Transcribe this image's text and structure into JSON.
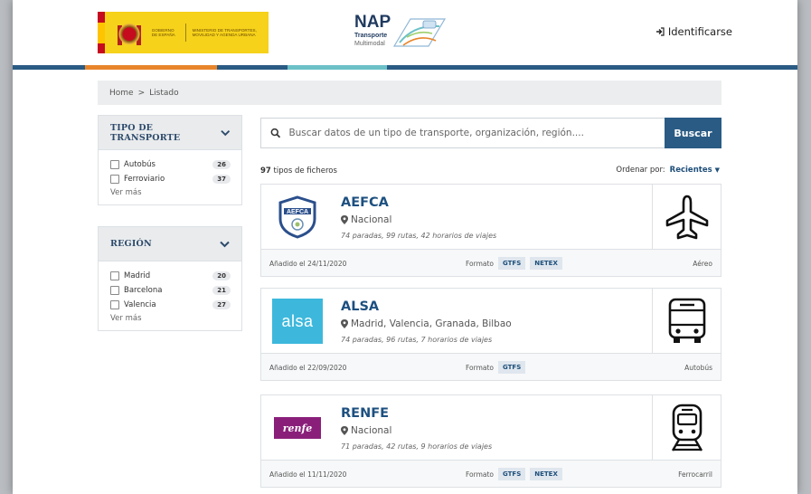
{
  "header": {
    "gov_text": "Gobierno de España",
    "ministry_text": "Ministerio de Transportes, Movilidad y Agenda Urbana",
    "nap_title": "NAP",
    "nap_subtitle": "Transporte",
    "nap_subtitle2": "Multimodal",
    "login_label": "Identificarse"
  },
  "colors": {
    "bar": [
      "#2a5b84",
      "#e8852b",
      "#2a5b84",
      "#6cc1c7",
      "#2a5b84"
    ],
    "accent": "#2a5b84",
    "link": "#1d5080"
  },
  "breadcrumb": {
    "home": "Home",
    "sep": ">",
    "current": "Listado"
  },
  "filters": {
    "transport": {
      "title": "TIPO DE TRANSPORTE",
      "options": [
        {
          "label": "Autobús",
          "count": "26"
        },
        {
          "label": "Ferroviario",
          "count": "37"
        }
      ],
      "more": "Ver más"
    },
    "region": {
      "title": "REGIÓN",
      "options": [
        {
          "label": "Madrid",
          "count": "20"
        },
        {
          "label": "Barcelona",
          "count": "21"
        },
        {
          "label": "Valencia",
          "count": "27"
        }
      ],
      "more": "Ver más"
    }
  },
  "search": {
    "placeholder": "Buscar datos de un tipo de transporte, organización, región....",
    "button": "Buscar"
  },
  "results": {
    "count": "97",
    "count_label": "tipos de ficheros",
    "sort_label": "Ordenar por:",
    "sort_value": "Recientes"
  },
  "cards": [
    {
      "name": "AEFCA",
      "location": "Nacional",
      "description": "74 paradas, 99 rutas, 42 horarios de viajes",
      "date": "Añadido el 24/11/2020",
      "format_label": "Formato",
      "formats": [
        "GTFS",
        "NETEX"
      ],
      "type": "Aéreo",
      "logo_text": "AEFCA",
      "mode_icon": "plane-icon"
    },
    {
      "name": "ALSA",
      "location": "Madrid, Valencia, Granada, Bilbao",
      "description": "74 paradas, 96 rutas, 7 horarios de viajes",
      "date": "Añadido el 22/09/2020",
      "format_label": "Formato",
      "formats": [
        "GTFS"
      ],
      "type": "Autobús",
      "logo_text": "alsa",
      "mode_icon": "bus-icon"
    },
    {
      "name": "RENFE",
      "location": "Nacional",
      "description": "71 paradas, 42 rutas, 9 horarios de viajes",
      "date": "Añadido el 11/11/2020",
      "format_label": "Formato",
      "formats": [
        "GTFS",
        "NETEX"
      ],
      "type": "Ferrocarril",
      "logo_text": "renfe",
      "mode_icon": "train-icon"
    }
  ]
}
